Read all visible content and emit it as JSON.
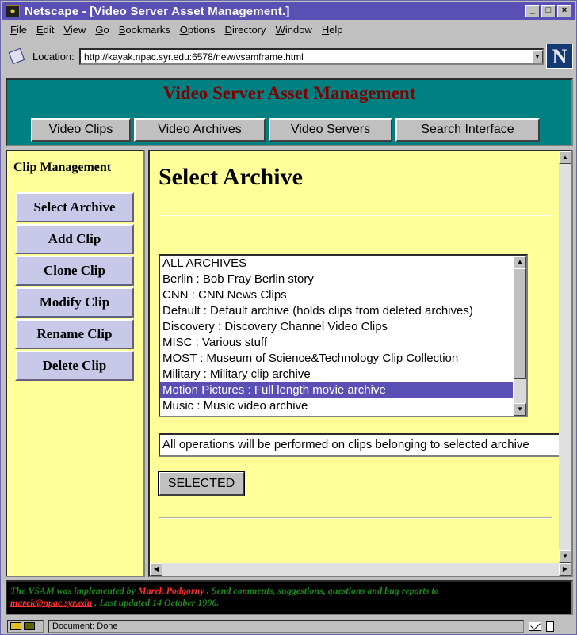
{
  "window": {
    "title": "Netscape - [Video Server Asset Management.]",
    "min_btn": "_",
    "max_btn": "□",
    "close_btn": "×"
  },
  "menu": [
    "File",
    "Edit",
    "View",
    "Go",
    "Bookmarks",
    "Options",
    "Directory",
    "Window",
    "Help"
  ],
  "location": {
    "label": "Location:",
    "url": "http://kayak.npac.syr.edu:6578/new/vsamframe.html"
  },
  "logo_letter": "N",
  "header": {
    "title": "Video Server Asset Management",
    "nav": [
      "Video Clips",
      "Video Archives",
      "Video Servers",
      "Search Interface"
    ]
  },
  "sidebar": {
    "title": "Clip Management",
    "buttons": [
      "Select Archive",
      "Add Clip",
      "Clone Clip",
      "Modify Clip",
      "Rename Clip",
      "Delete Clip"
    ]
  },
  "main": {
    "title": "Select Archive",
    "archives": [
      "ALL ARCHIVES",
      "Berlin : Bob Fray Berlin story",
      "CNN : CNN News Clips",
      "Default : Default archive (holds clips from deleted archives)",
      "Discovery : Discovery Channel Video Clips",
      "MISC : Various stuff",
      "MOST : Museum of Science&Technology Clip Collection",
      "Military : Military clip archive",
      "Motion Pictures : Full length movie archive",
      "Music : Music video archive"
    ],
    "selected_index": 8,
    "info_text": "All operations will be performed on clips belonging to selected archive",
    "selected_button": "SELECTED"
  },
  "footer": {
    "text1": "The VSAM was implemented by ",
    "author": "Marek Podgorny",
    "text2": " . Send comments, suggestions, questions and bug reports to",
    "email": "marek@npac.syr.edu",
    "text3": " . Last updated 14 October 1996."
  },
  "status": {
    "text": "Document: Done"
  },
  "colors": {
    "title_bar": "#5a4fb4",
    "header_bg": "#008080",
    "header_title": "#800000",
    "frame_bg": "#ffff99",
    "sidebar_button": "#c8c8e8",
    "selection": "#5a4fb4",
    "footer_text": "#228822",
    "footer_link": "#ff3030"
  }
}
